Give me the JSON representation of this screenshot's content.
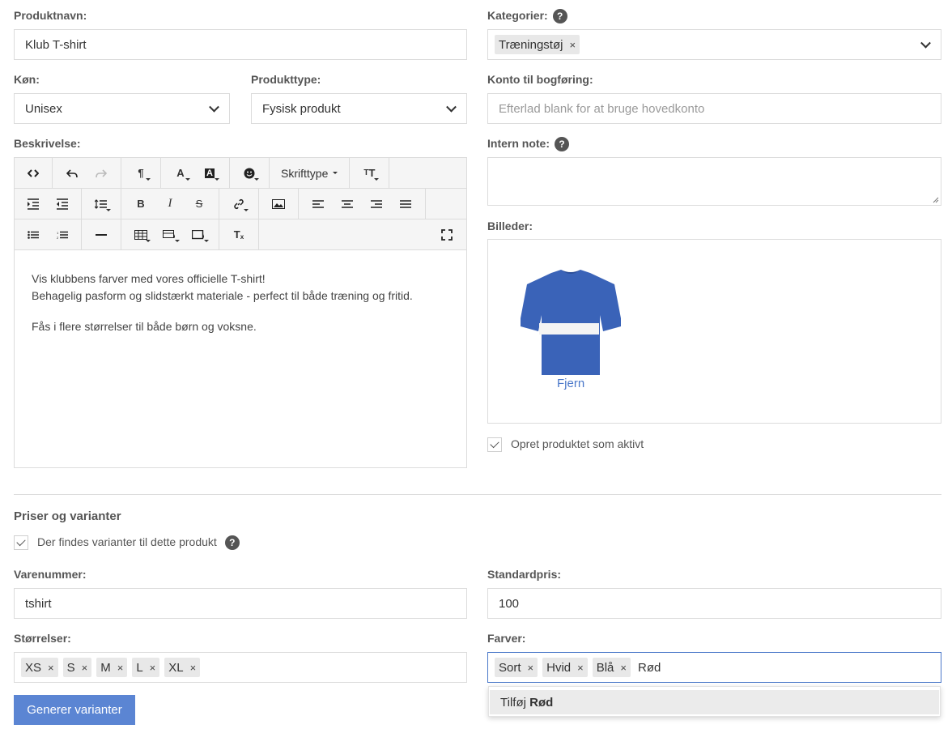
{
  "product_name": {
    "label": "Produktnavn:",
    "value": "Klub T-shirt"
  },
  "categories": {
    "label": "Kategorier:",
    "help": "?",
    "tags": [
      "Træningstøj"
    ],
    "remove_glyph": "×"
  },
  "gender": {
    "label": "Køn:",
    "value": "Unisex"
  },
  "product_type": {
    "label": "Produkttype:",
    "value": "Fysisk produkt"
  },
  "account": {
    "label": "Konto til bogføring:",
    "placeholder": "Efterlad blank for at bruge hovedkonto"
  },
  "description": {
    "label": "Beskrivelse:",
    "toolbar": {
      "font_label": "Skrifttype"
    },
    "lines": [
      "Vis klubbens farver med vores officielle T-shirt!",
      "Behagelig pasform og slidstærkt materiale - perfect til både træning og fritid.",
      "Fås i flere størrelser til både børn og voksne."
    ]
  },
  "internal_note": {
    "label": "Intern note:",
    "help": "?",
    "value": ""
  },
  "images": {
    "label": "Billeder:",
    "remove_label": "Fjern",
    "shirt_color": "#3a63b8"
  },
  "active_checkbox": {
    "label": "Opret produktet som aktivt",
    "checked": true
  },
  "pricing": {
    "section_title": "Priser og varianter",
    "variants_checkbox": {
      "label": "Der findes varianter til dette produkt",
      "checked": true,
      "help": "?"
    }
  },
  "sku": {
    "label": "Varenummer:",
    "value": "tshirt"
  },
  "price": {
    "label": "Standardpris:",
    "value": "100"
  },
  "sizes": {
    "label": "Størrelser:",
    "tags": [
      "XS",
      "S",
      "M",
      "L",
      "XL"
    ]
  },
  "colors": {
    "label": "Farver:",
    "tags": [
      "Sort",
      "Hvid",
      "Blå"
    ],
    "input_value": "Rød",
    "suggestion": {
      "prefix": "Tilføj ",
      "value": "Rød"
    }
  },
  "generate_button": {
    "label": "Generer varianter"
  },
  "theme": {
    "primary": "#5b85d3",
    "border": "#dcdcdc",
    "focus_border": "#4a78c9"
  }
}
